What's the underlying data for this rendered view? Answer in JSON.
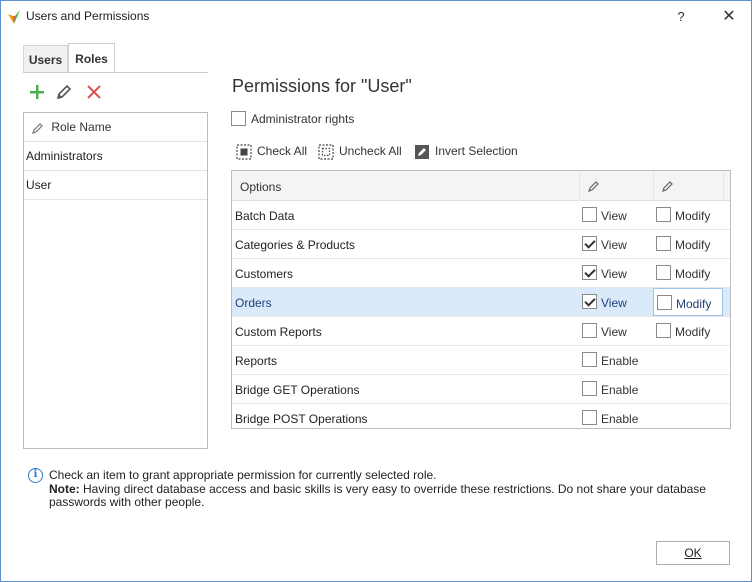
{
  "window": {
    "title": "Users and Permissions",
    "help_label": "?",
    "close_label": "✕",
    "icon": "app-logo-icon"
  },
  "tabs": [
    {
      "label": "Users",
      "active": false
    },
    {
      "label": "Roles",
      "active": true
    }
  ],
  "role_toolbar": {
    "add_icon": "plus-icon",
    "edit_icon": "pencil-icon",
    "delete_icon": "close-icon"
  },
  "role_list": {
    "header": "Role Name",
    "rows": [
      {
        "name": "Administrators"
      },
      {
        "name": "User"
      }
    ]
  },
  "permissions": {
    "title": "Permissions for \"User\"",
    "admin_rights_label": "Administrator rights",
    "admin_rights_checked": false,
    "check_all_label": "Check All",
    "uncheck_all_label": "Uncheck All",
    "invert_selection_label": "Invert Selection",
    "grid": {
      "header_options": "Options",
      "rows": [
        {
          "label": "Batch Data",
          "first": "View",
          "first_checked": false,
          "second": "Modify",
          "second_checked": false
        },
        {
          "label": "Categories & Products",
          "first": "View",
          "first_checked": true,
          "second": "Modify",
          "second_checked": false
        },
        {
          "label": "Customers",
          "first": "View",
          "first_checked": true,
          "second": "Modify",
          "second_checked": false
        },
        {
          "label": "Orders",
          "first": "View",
          "first_checked": true,
          "second": "Modify",
          "second_checked": false,
          "selected": true
        },
        {
          "label": "Custom Reports",
          "first": "View",
          "first_checked": false,
          "second": "Modify",
          "second_checked": false
        },
        {
          "label": "Reports",
          "first": "Enable",
          "first_checked": false
        },
        {
          "label": "Bridge GET Operations",
          "first": "Enable",
          "first_checked": false
        },
        {
          "label": "Bridge POST Operations",
          "first": "Enable",
          "first_checked": false
        }
      ]
    }
  },
  "info": {
    "line1": "Check an item to grant appropriate permission for currently selected role.",
    "note_label": "Note:",
    "note_text": " Having direct database access and basic skills is very easy to override these restrictions. Do not share your database passwords with other people."
  },
  "ok_label": "OK",
  "colors": {
    "accent": "#2b78c5",
    "selected_row": "#dbeafb",
    "add_green": "#4caf50",
    "delete_red": "#d9534f"
  }
}
